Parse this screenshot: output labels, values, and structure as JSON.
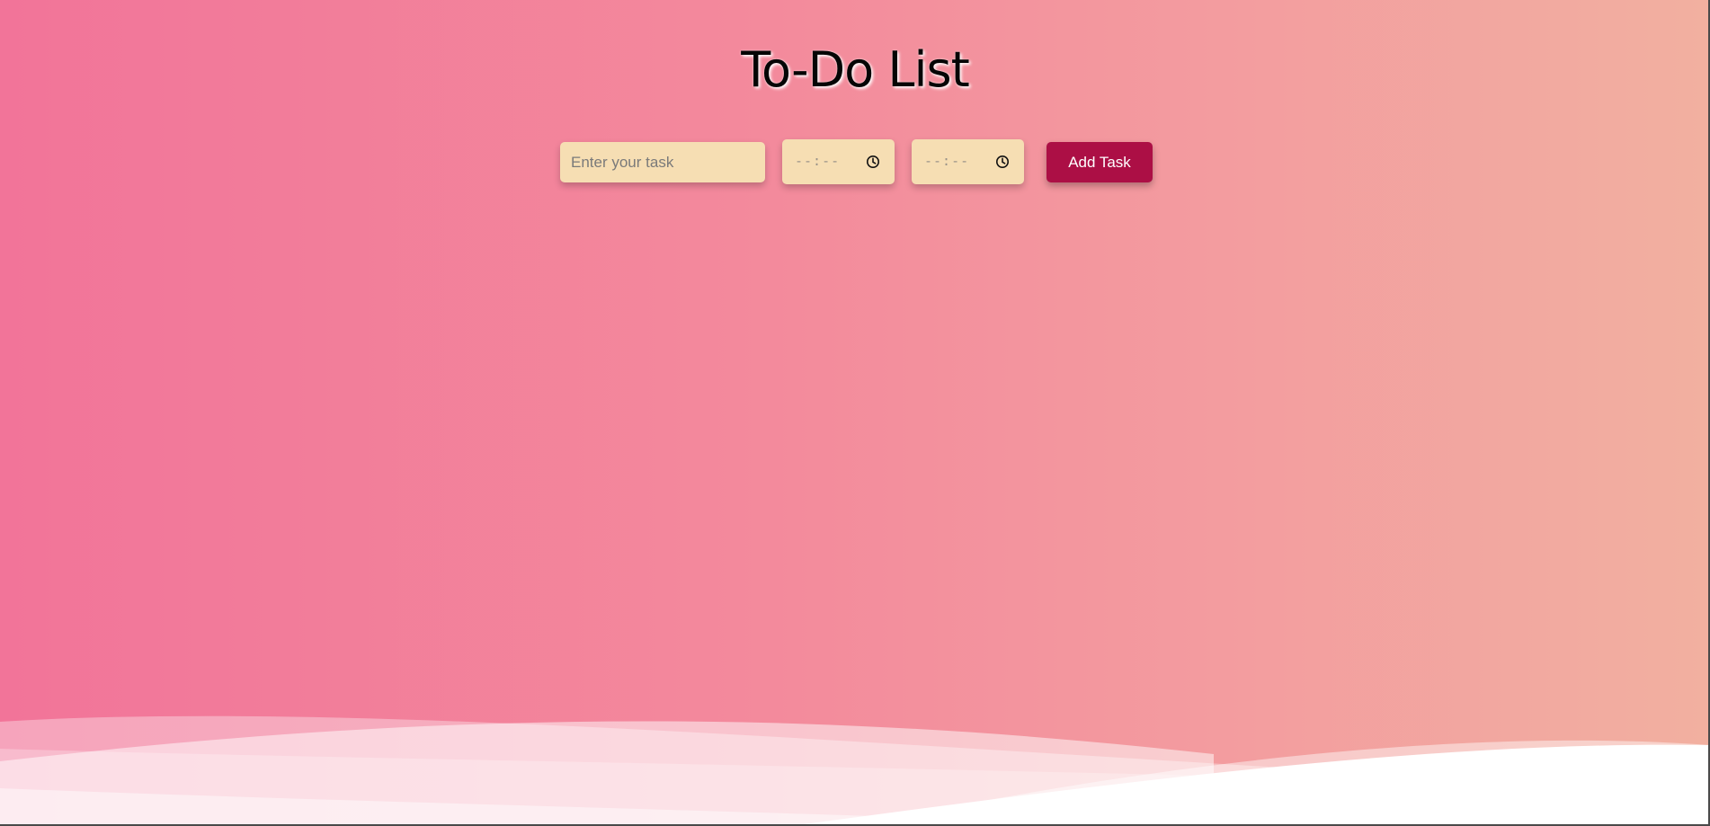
{
  "app": {
    "title": "To-Do List"
  },
  "form": {
    "task_placeholder": "Enter your task",
    "start_time_value": "--:--",
    "end_time_value": "--:--",
    "add_button_label": "Add Task"
  },
  "icons": {
    "time_picker": "clock-icon"
  },
  "colors": {
    "background_gradient_start": "#f27499",
    "background_gradient_end": "#f2b0a0",
    "input_background": "#f6deb3",
    "button_background": "#ac0f45",
    "button_text": "#ffffff",
    "title_text": "#050505"
  }
}
